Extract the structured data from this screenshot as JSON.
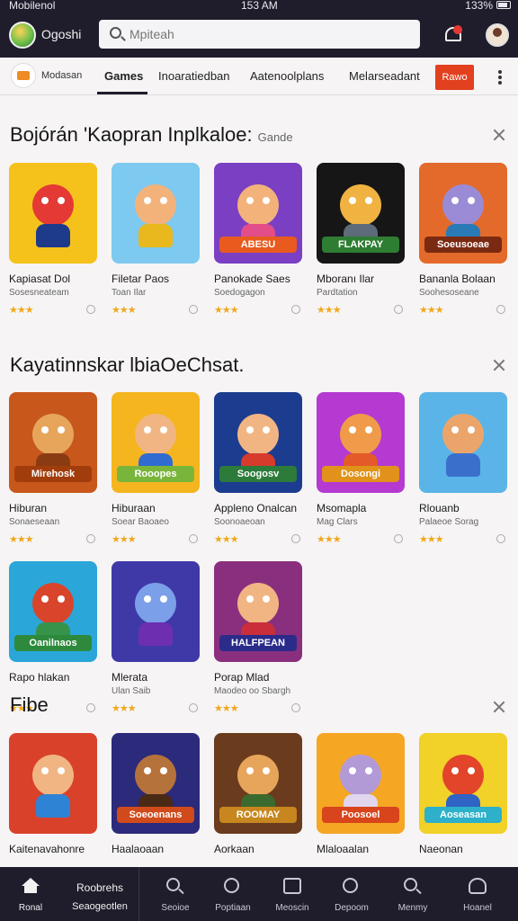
{
  "status_bar": {
    "carrier": "Mobilenol",
    "time": "153 AM",
    "battery": "133%"
  },
  "header": {
    "app_name": "Ogoshi",
    "search_placeholder": "Mpiteah"
  },
  "tabs": {
    "brand_label": "Modasan",
    "items": [
      {
        "label": "Games",
        "active": true
      },
      {
        "label": "Inoaratiedban",
        "active": false
      },
      {
        "label": "Aatenoolplans",
        "active": false
      },
      {
        "label": "Melarseadant",
        "active": false
      }
    ],
    "new_button": "Rawo"
  },
  "sections": [
    {
      "title": "Bojórán 'Kaopran Inplkaloe:",
      "subtitle": "Gande",
      "cards": [
        {
          "name": "Kapiasat Dol",
          "sub": "Sosesneateam",
          "thumb_bg": "#f5c21b",
          "face": "#e53935",
          "body": "#1e3a8a",
          "bar": "",
          "bar_bg": "transparent"
        },
        {
          "name": "Filetar Paos",
          "sub": "Toan Ilar",
          "thumb_bg": "#7ec9ef",
          "face": "#f2b27a",
          "body": "#e8b81c",
          "bar": "",
          "bar_bg": "transparent"
        },
        {
          "name": "Panokade Saes",
          "sub": "Soedogagon",
          "thumb_bg": "#7b3fc4",
          "face": "#f2b27a",
          "body": "#e24d8a",
          "bar": "ABESU",
          "bar_bg": "#e85a1e"
        },
        {
          "name": "Mboranı Ilar",
          "sub": "Pardtation",
          "thumb_bg": "#161616",
          "face": "#f0b341",
          "body": "#5d6b7a",
          "bar": "FLAKPAY",
          "bar_bg": "#2e7d32"
        },
        {
          "name": "Bananla Bolaan",
          "sub": "Soohesoseane",
          "thumb_bg": "#e36a2a",
          "face": "#9b8bd6",
          "body": "#2a7ab8",
          "bar": "Soeusoeae",
          "bar_bg": "#7b2a12"
        }
      ]
    },
    {
      "title": "Kayatinnskar lbiaOeChsat.",
      "subtitle": "",
      "cards": [
        {
          "name": "Hiburan",
          "sub": "Sonaeseaan",
          "thumb_bg": "#c8571c",
          "face": "#e7a55c",
          "body": "#8a3b12",
          "bar": "Mirehosk",
          "bar_bg": "#a13d0c"
        },
        {
          "name": "Hiburaan",
          "sub": "Soear Baoaeo",
          "thumb_bg": "#f4b51e",
          "face": "#f1b583",
          "body": "#2f6bd1",
          "bar": "Rooopes",
          "bar_bg": "#7ab53b"
        },
        {
          "name": "Appleno Onalcan",
          "sub": "Soonoaeoan",
          "thumb_bg": "#1b3c8f",
          "face": "#f1b583",
          "body": "#d63b2b",
          "bar": "Soogosv",
          "bar_bg": "#2d7b3a"
        },
        {
          "name": "Msomapla",
          "sub": "Mag Clars",
          "thumb_bg": "#b43ad1",
          "face": "#ef9b4a",
          "body": "#e45a29",
          "bar": "Dosongi",
          "bar_bg": "#e0921b"
        },
        {
          "name": "Rlouanb",
          "sub": "Palaeoe Sorag",
          "thumb_bg": "#5ab4e8",
          "face": "#eba56b",
          "body": "#3b6fcc",
          "bar": "",
          "bar_bg": "transparent"
        },
        {
          "name": "Rapo hlakan",
          "sub": "",
          "thumb_bg": "#2aa6d9",
          "face": "#d9452b",
          "body": "#35944a",
          "bar": "Oanilnaos",
          "bar_bg": "#2d8a3c"
        },
        {
          "name": "Mlerata",
          "sub": "Ulan Saib",
          "thumb_bg": "#3f39a8",
          "face": "#7b9fe8",
          "body": "#6d2fb0",
          "bar": "",
          "bar_bg": "transparent"
        },
        {
          "name": "Porap Mlad",
          "sub": "Maodeo oo Sbargh",
          "thumb_bg": "#8a2f7e",
          "face": "#f1b583",
          "body": "#c92e3a",
          "bar": "HALFPEAN",
          "bar_bg": "#2b2b8a"
        }
      ]
    },
    {
      "title": "Fibe",
      "subtitle": "",
      "cards": [
        {
          "name": "Kaitenavahonre",
          "sub": "",
          "thumb_bg": "#d9412b",
          "face": "#f1b583",
          "body": "#2f83d4",
          "bar": "",
          "bar_bg": "transparent"
        },
        {
          "name": "Haalaoaan",
          "sub": "",
          "thumb_bg": "#2c2a7a",
          "face": "#b5723a",
          "body": "#4a2a14",
          "bar": "Soeoenans",
          "bar_bg": "#d04a1c"
        },
        {
          "name": "Aorkaan",
          "sub": "",
          "thumb_bg": "#6b3b1e",
          "face": "#e7a55c",
          "body": "#3b6a2e",
          "bar": "ROOMAY",
          "bar_bg": "#c7861e"
        },
        {
          "name": "Mlaloaalan",
          "sub": "",
          "thumb_bg": "#f5a623",
          "face": "#b29ad6",
          "body": "#e0d6ee",
          "bar": "Poosoel",
          "bar_bg": "#d8441c"
        },
        {
          "name": "Naeonan",
          "sub": "",
          "thumb_bg": "#f2d128",
          "face": "#e3452b",
          "body": "#2f63c4",
          "bar": "Aoseasan",
          "bar_bg": "#2db0c9"
        }
      ]
    }
  ],
  "bottom_nav": {
    "items": [
      {
        "label": "Ronal",
        "icon": "home-icon",
        "active": true
      },
      {
        "label": "Seoioe",
        "icon": "search-icon",
        "active": false
      },
      {
        "label": "Poptiaan",
        "icon": "apps-icon",
        "active": false
      },
      {
        "label": "Meoscin",
        "icon": "library-icon",
        "active": false
      },
      {
        "label": "Depoom",
        "icon": "circle-icon",
        "active": false
      },
      {
        "label": "Menmy",
        "icon": "search2-icon",
        "active": false
      },
      {
        "label": "Hoanel",
        "icon": "user-icon",
        "active": false
      }
    ],
    "promo_title": "Roobrehs",
    "promo_sub": "Seaogeotlen"
  },
  "colors": {
    "bar_dark": "#1f1d2b",
    "accent": "#e2401f",
    "star": "#f0a81c"
  }
}
